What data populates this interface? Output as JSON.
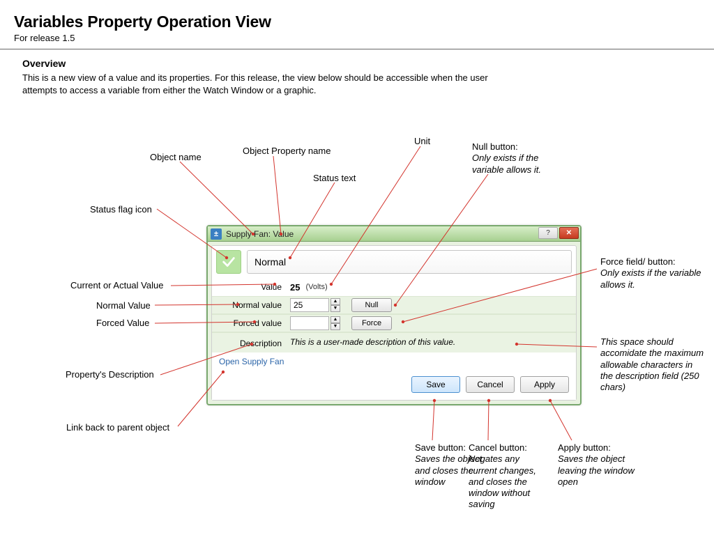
{
  "header": {
    "title": "Variables Property Operation View",
    "subtitle": "For release 1.5"
  },
  "overview": {
    "heading": "Overview",
    "text": "This is a new view of a value and its properties. For this release, the view below should be accessible when the user attempts to access a variable from either the Watch Window or a graphic."
  },
  "dialog": {
    "title": "Supply Fan: Value",
    "status_text": "Normal",
    "labels": {
      "value": "Value",
      "normal": "Normal value",
      "forced": "Forced value",
      "description": "Description"
    },
    "value": "25",
    "unit": "(Volts)",
    "normal_value": "25",
    "forced_value": "",
    "null_btn": "Null",
    "force_btn": "Force",
    "description_text": "This is a user-made description of this value.",
    "parent_link": "Open Supply Fan",
    "buttons": {
      "save": "Save",
      "cancel": "Cancel",
      "apply": "Apply"
    }
  },
  "callouts": {
    "object_name": "Object name",
    "object_prop_name": "Object Property name",
    "unit": "Unit",
    "status_text": "Status text",
    "status_flag": "Status flag icon",
    "current_value": "Current or Actual Value",
    "normal_value": "Normal Value",
    "forced_value": "Forced Value",
    "prop_desc": "Property's Description",
    "link_back": "Link back to parent object",
    "null_btn": {
      "title": "Null button:",
      "sub": "Only exists if the variable allows it."
    },
    "force_btn": {
      "title": "Force field/ button:",
      "sub": "Only exists if the variable allows it."
    },
    "desc_space": {
      "title": "",
      "sub": "This space should accomidate the maximum allowable characters in the description field (250 chars)"
    },
    "save_btn": {
      "title": "Save button:",
      "sub": "Saves the object and closes the window"
    },
    "cancel_btn": {
      "title": "Cancel button:",
      "sub": "Negates any current changes, and closes the window without saving"
    },
    "apply_btn": {
      "title": "Apply button:",
      "sub": "Saves the object leaving the window open"
    }
  }
}
